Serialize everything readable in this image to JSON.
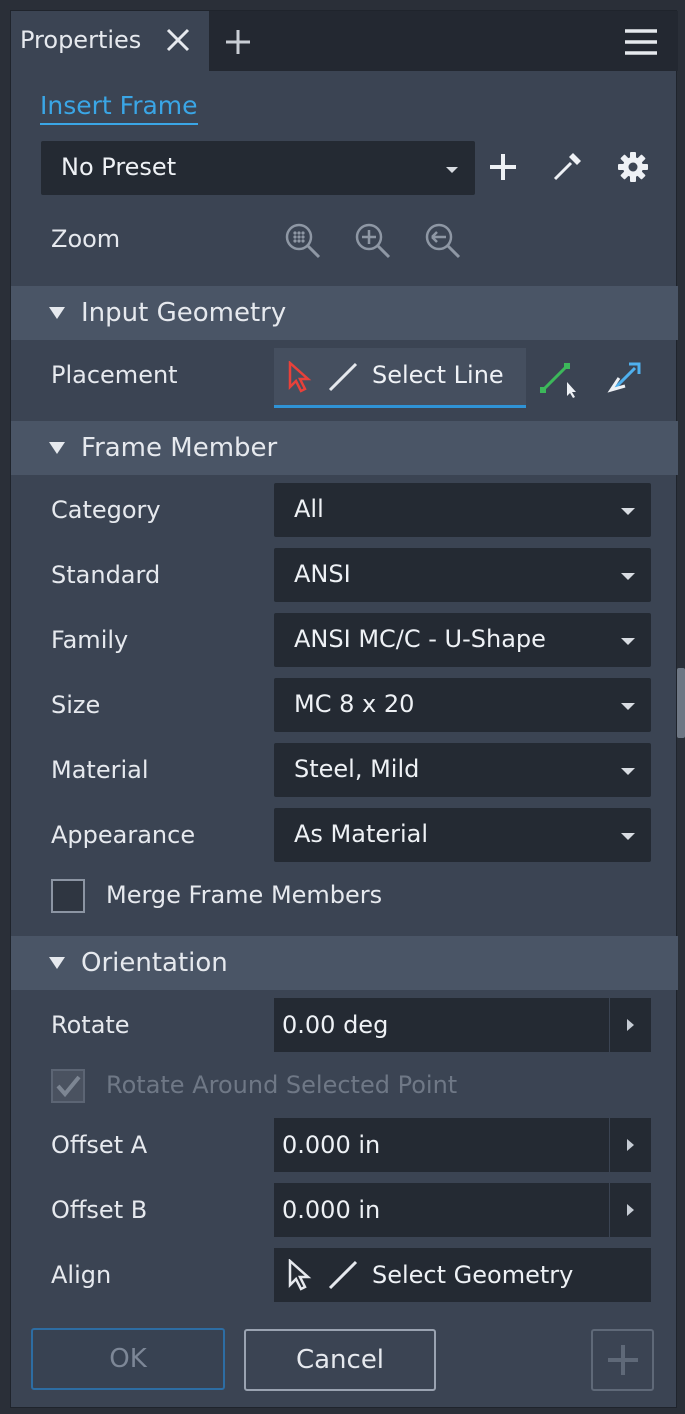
{
  "window": {
    "tab_label": "Properties",
    "tab_close_icon": "close-icon",
    "tab_add_icon": "plus-icon",
    "menu_icon": "hamburger-menu-icon"
  },
  "header": {
    "title": "Insert Frame",
    "preset_value": "No Preset",
    "add_preset_icon": "plus-icon",
    "pick_icon": "eyedropper-icon",
    "settings_icon": "gear-icon"
  },
  "zoom": {
    "label": "Zoom",
    "icons": [
      "zoom-all-icon",
      "zoom-in-icon",
      "zoom-previous-icon"
    ]
  },
  "input_geometry": {
    "section_label": "Input Geometry",
    "placement_label": "Placement",
    "select_line_label": "Select Line",
    "extra_icons": [
      "line-pick-icon",
      "flip-arrows-icon"
    ]
  },
  "frame_member": {
    "section_label": "Frame Member",
    "fields": [
      {
        "label": "Category",
        "value": "All"
      },
      {
        "label": "Standard",
        "value": "ANSI"
      },
      {
        "label": "Family",
        "value": "ANSI MC/C - U-Shape"
      },
      {
        "label": "Size",
        "value": "MC 8 x 20"
      },
      {
        "label": "Material",
        "value": "Steel, Mild"
      },
      {
        "label": "Appearance",
        "value": "As Material"
      }
    ],
    "merge_label": "Merge Frame Members",
    "merge_checked": false
  },
  "orientation": {
    "section_label": "Orientation",
    "rotate_label": "Rotate",
    "rotate_value": "0.00 deg",
    "rotate_around_label": "Rotate Around Selected Point",
    "rotate_around_checked": true,
    "offset_a_label": "Offset A",
    "offset_a_value": "0.000 in",
    "offset_b_label": "Offset B",
    "offset_b_value": "0.000 in",
    "align_label": "Align",
    "select_geometry_label": "Select Geometry"
  },
  "footer": {
    "ok_label": "OK",
    "cancel_label": "Cancel",
    "apply_icon": "plus-icon"
  },
  "colors": {
    "accent": "#3aa6e6",
    "panel_bg": "#3b4453",
    "section_bg": "#4a5566",
    "field_bg": "#242a33"
  }
}
